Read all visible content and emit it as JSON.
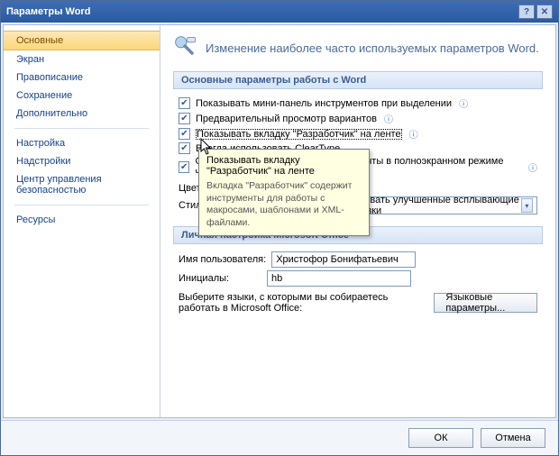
{
  "window": {
    "title": "Параметры Word"
  },
  "sidebar": {
    "items": [
      {
        "label": "Основные",
        "selected": true
      },
      {
        "label": "Экран"
      },
      {
        "label": "Правописание"
      },
      {
        "label": "Сохранение"
      },
      {
        "label": "Дополнительно"
      }
    ],
    "items2": [
      {
        "label": "Настройка"
      },
      {
        "label": "Надстройки"
      },
      {
        "label": "Центр управления безопасностью"
      }
    ],
    "items3": [
      {
        "label": "Ресурсы"
      }
    ]
  },
  "header": {
    "text": "Изменение наиболее часто используемых параметров Word."
  },
  "section1": {
    "title": "Основные параметры работы с Word",
    "opts": [
      {
        "label": "Показывать мини-панель инструментов при выделении",
        "hint": true
      },
      {
        "label": "Предварительный просмотр вариантов",
        "hint": true
      },
      {
        "label": "Показывать вкладку \"Разработчик\" на ленте",
        "hint": true,
        "highlight": true
      },
      {
        "label": "Всегда использовать ClearType"
      },
      {
        "label": "Открывать вложения электронной почты в полноэкранном режиме чтения",
        "hint": true
      }
    ],
    "color_label": "Цветовая схема:",
    "style_label": "Стиль всплывающих подсказок:",
    "style_value": "Показывать улучшенные всплывающие подсказки"
  },
  "tooltip": {
    "title": "Показывать вкладку \"Разработчик\" на ленте",
    "body": "Вкладка \"Разработчик\" содержит инструменты для работы с макросами, шаблонами и XML-файлами."
  },
  "section2": {
    "title": "Личная настройка Microsoft Office",
    "user_label": "Имя пользователя:",
    "user_value": "Христофор Бонифатьевич",
    "init_label": "Инициалы:",
    "init_value": "hb",
    "lang_text": "Выберите языки, с которыми вы собираетесь работать в Microsoft Office:",
    "lang_btn": "Языковые параметры..."
  },
  "footer": {
    "ok": "ОК",
    "cancel": "Отмена"
  }
}
